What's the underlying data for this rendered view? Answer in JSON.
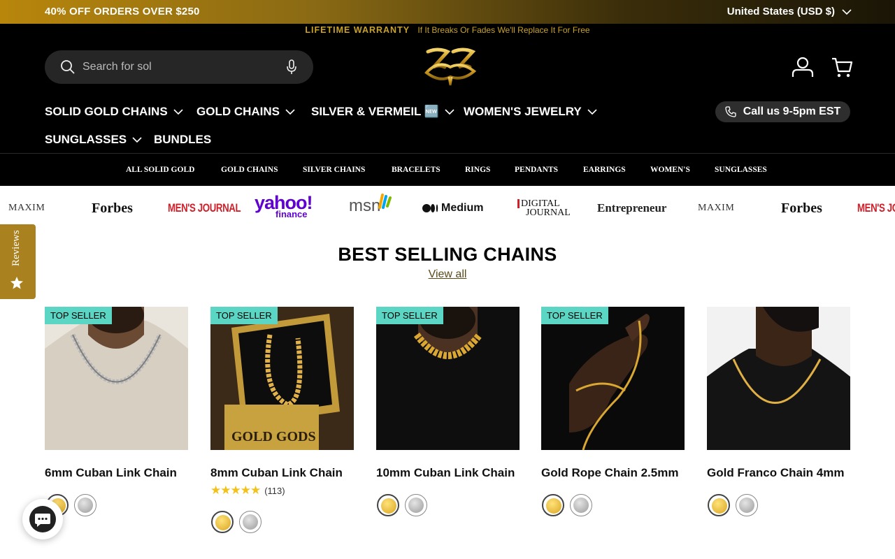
{
  "promo": {
    "text": "40% OFF ORDERS OVER $250",
    "country": "United States (USD $)"
  },
  "warranty": {
    "title": "LIFETIME WARRANTY",
    "text": "If It Breaks Or Fades We'll Replace It For Free"
  },
  "search": {
    "placeholder": "Search for sol"
  },
  "main_nav": [
    {
      "label": "SOLID GOLD CHAINS",
      "dropdown": true
    },
    {
      "label": "GOLD CHAINS",
      "dropdown": true
    },
    {
      "label": "SILVER & VERMEIL 🆕",
      "dropdown": true
    },
    {
      "label": "WOMEN'S JEWELRY",
      "dropdown": true
    },
    {
      "label": "SUNGLASSES",
      "dropdown": true
    },
    {
      "label": "BUNDLES",
      "dropdown": false
    }
  ],
  "call_button": {
    "label": "Call us 9-5pm EST"
  },
  "sub_nav": [
    "ALL SOLID GOLD",
    "GOLD CHAINS",
    "SILVER CHAINS",
    "BRACELETS",
    "RINGS",
    "PENDANTS",
    "EARRINGS",
    "WOMEN'S",
    "SUNGLASSES"
  ],
  "press_logos": [
    "MAXIM",
    "Forbes",
    "MEN'S JOURNAL",
    "yahoo!",
    "finance",
    "msn",
    "Medium",
    "DIGITAL",
    "JOURNAL",
    "Entrepreneur",
    "MAXIM",
    "Forbes",
    "MEN'S JOURNAL"
  ],
  "section": {
    "title": "BEST SELLING CHAINS",
    "view_all": "View all"
  },
  "reviews_tab": {
    "label": "Reviews"
  },
  "products": [
    {
      "name": "6mm Cuban Link Chain",
      "badge": "TOP SELLER"
    },
    {
      "name": "8mm Cuban Link Chain",
      "badge": "TOP SELLER",
      "rating_stars": "★★★★★",
      "rating_count": "(113)",
      "rating_value": 5
    },
    {
      "name": "10mm Cuban Link Chain",
      "badge": "TOP SELLER"
    },
    {
      "name": "Gold Rope Chain 2.5mm",
      "badge": "TOP SELLER"
    },
    {
      "name": "Gold Franco Chain 4mm",
      "badge": ""
    }
  ],
  "colors": {
    "gold": "#c9a227",
    "badge": "#5cd6c4",
    "silver": "#b8b8b8"
  }
}
